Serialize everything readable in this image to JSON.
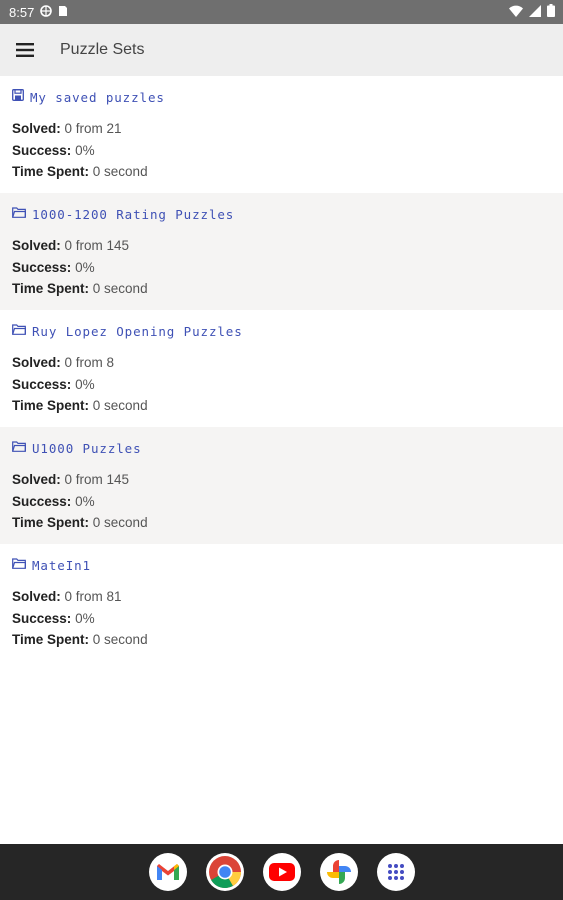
{
  "status_bar": {
    "time": "8:57",
    "icons_left": [
      "vpn-icon",
      "sim-card-icon"
    ],
    "icons_right": [
      "wifi-icon",
      "signal-icon",
      "battery-icon"
    ]
  },
  "app_bar": {
    "menu_icon": "hamburger-menu-icon",
    "title": "Puzzle Sets"
  },
  "labels": {
    "solved": "Solved:",
    "success": "Success:",
    "time_spent": "Time Spent:"
  },
  "puzzle_sets": [
    {
      "icon": "save-icon",
      "name": "My saved puzzles",
      "solved": "0 from 21",
      "success": "0%",
      "time_spent": "0 second"
    },
    {
      "icon": "folder-icon",
      "name": "1000-1200 Rating Puzzles",
      "solved": "0 from 145",
      "success": "0%",
      "time_spent": "0 second"
    },
    {
      "icon": "folder-icon",
      "name": "Ruy Lopez Opening Puzzles",
      "solved": "0 from 8",
      "success": "0%",
      "time_spent": "0 second"
    },
    {
      "icon": "folder-icon",
      "name": "U1000 Puzzles",
      "solved": "0 from 145",
      "success": "0%",
      "time_spent": "0 second"
    },
    {
      "icon": "folder-icon",
      "name": "MateIn1",
      "solved": "0 from 81",
      "success": "0%",
      "time_spent": "0 second"
    }
  ],
  "dock": [
    "gmail-icon",
    "chrome-icon",
    "youtube-icon",
    "photos-icon",
    "app-drawer-icon"
  ],
  "colors": {
    "accent": "#3f51b5",
    "app_bar": "#eeeeee",
    "alt_row": "#f5f4f3",
    "status_bar": "#6f6f6f",
    "nav_bar": "#262626"
  }
}
